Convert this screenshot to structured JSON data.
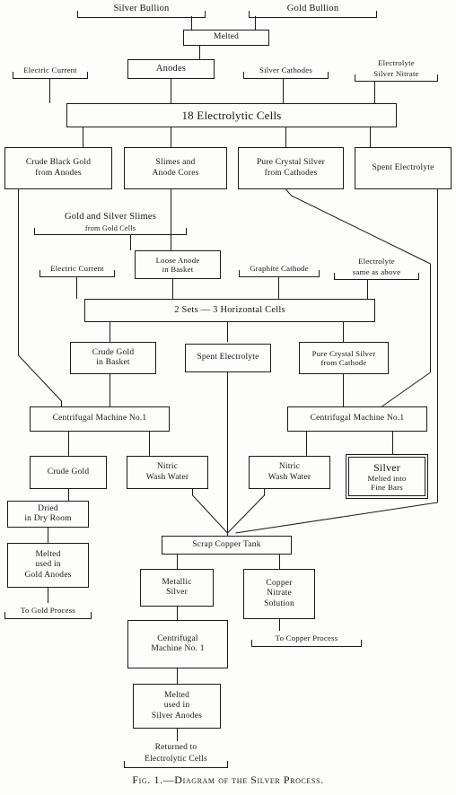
{
  "figure": {
    "caption": "Fig. 1.—Diagram of the Silver Process.",
    "title": "Diagram of the Silver Process",
    "ink_color": "#1b1b1b",
    "paper_color": "#fdfdfc"
  },
  "nodes": {
    "silver_bullion": {
      "label": "Silver Bullion"
    },
    "gold_bullion": {
      "label": "Gold Bullion"
    },
    "melted": {
      "label": "Melted"
    },
    "electric_current_1": {
      "label": "Electric Current"
    },
    "anodes": {
      "label": "Anodes"
    },
    "silver_cathodes": {
      "label": "Silver Cathodes"
    },
    "electrolyte_nitrate_1": {
      "label": "Electrolyte"
    },
    "electrolyte_nitrate_2": {
      "label": "Silver Nitrate"
    },
    "cells_18": {
      "label": "18 Electrolytic Cells"
    },
    "crude_black_gold_1": {
      "label": "Crude Black Gold"
    },
    "crude_black_gold_2": {
      "label": "from Anodes"
    },
    "slimes_anode_cores_1": {
      "label": "Slimes and"
    },
    "slimes_anode_cores_2": {
      "label": "Anode Cores"
    },
    "pure_crystal_silver_1": {
      "label": "Pure Crystal Silver"
    },
    "pure_crystal_silver_2": {
      "label": "from Cathodes"
    },
    "spent_electrolyte_top": {
      "label": "Spent Electrolyte"
    },
    "gold_silver_slimes_1": {
      "label": "Gold and Silver Slimes"
    },
    "gold_silver_slimes_2": {
      "label": "from Gold Cells"
    },
    "electric_current_2": {
      "label": "Electric Current"
    },
    "loose_anode_1": {
      "label": "Loose Anode"
    },
    "loose_anode_2": {
      "label": "in Basket"
    },
    "graphite_cathode": {
      "label": "Graphite Cathode"
    },
    "electrolyte_same_1": {
      "label": "Electrolyte"
    },
    "electrolyte_same_2": {
      "label": "same as above"
    },
    "horizontal_cells": {
      "label": "2 Sets — 3 Horizontal Cells"
    },
    "crude_gold_basket_1": {
      "label": "Crude Gold"
    },
    "crude_gold_basket_2": {
      "label": "in  Basket"
    },
    "spent_electrolyte_mid": {
      "label": "Spent Electrolyte"
    },
    "pure_crystal_cathode_1": {
      "label": "Pure Crystal Silver"
    },
    "pure_crystal_cathode_2": {
      "label": "from  Cathode"
    },
    "centrifugal_left": {
      "label": "Centrifugal Machine No.1"
    },
    "centrifugal_right": {
      "label": "Centrifugal Machine No.1"
    },
    "crude_gold": {
      "label": "Crude Gold"
    },
    "nitric_wash_left_1": {
      "label": "Nitric"
    },
    "nitric_wash_left_2": {
      "label": "Wash Water"
    },
    "nitric_wash_right_1": {
      "label": "Nitric"
    },
    "nitric_wash_right_2": {
      "label": "Wash Water"
    },
    "silver_bars_1": {
      "label": "Silver"
    },
    "silver_bars_2": {
      "label": "Melted into"
    },
    "silver_bars_3": {
      "label": "Fine Bars"
    },
    "dried_dry_room_1": {
      "label": "Dried"
    },
    "dried_dry_room_2": {
      "label": "in Dry Room"
    },
    "melted_gold_anodes_1": {
      "label": "Melted"
    },
    "melted_gold_anodes_2": {
      "label": "used in"
    },
    "melted_gold_anodes_3": {
      "label": "Gold Anodes"
    },
    "to_gold_process": {
      "label": "To Gold Process"
    },
    "scrap_copper_tank": {
      "label": "Scrap Copper Tank"
    },
    "metallic_silver_1": {
      "label": "Metallic"
    },
    "metallic_silver_2": {
      "label": "Silver"
    },
    "copper_nitrate_1": {
      "label": "Copper"
    },
    "copper_nitrate_2": {
      "label": "Nitrate"
    },
    "copper_nitrate_3": {
      "label": "Solution"
    },
    "to_copper_process": {
      "label": "To Copper Process"
    },
    "centrifugal_bottom_1": {
      "label": "Centrifugal"
    },
    "centrifugal_bottom_2": {
      "label": "Machine No. 1"
    },
    "melted_silver_anodes_1": {
      "label": "Melted"
    },
    "melted_silver_anodes_2": {
      "label": "used in"
    },
    "melted_silver_anodes_3": {
      "label": "Silver Anodes"
    },
    "returned_cells_1": {
      "label": "Returned to"
    },
    "returned_cells_2": {
      "label": "Electrolytic Cells"
    }
  },
  "flow": {
    "stages": [
      "Silver Bullion and Gold Bullion are Melted into Anodes",
      "Anodes, Electric Current, Silver Cathodes and Electrolyte (Silver Nitrate) feed 18 Electrolytic Cells",
      "Cells yield Crude Black Gold from Anodes, Slimes and Anode Cores, Pure Crystal Silver from Cathodes, and Spent Electrolyte",
      "Gold and Silver Slimes from Gold Cells plus Loose Anode in Basket, Electric Current, Graphite Cathode and Electrolyte feed 2 Sets — 3 Horizontal Cells",
      "Horizontal Cells yield Crude Gold in Basket, Spent Electrolyte, and Pure Crystal Silver from Cathode",
      "Centrifugal Machine No.1 (left) gives Crude Gold and Nitric Wash Water",
      "Centrifugal Machine No.1 (right) gives Nitric Wash Water and Silver Melted into Fine Bars",
      "Crude Gold is Dried in Dry Room, Melted used in Gold Anodes, then To Gold Process",
      "Wash waters and Spent Electrolyte go to the Scrap Copper Tank",
      "Scrap Copper Tank yields Metallic Silver and Copper Nitrate Solution",
      "Metallic Silver goes to Centrifugal Machine No. 1, is Melted used in Silver Anodes, and Returned to Electrolytic Cells",
      "Copper Nitrate Solution goes To Copper Process"
    ]
  }
}
